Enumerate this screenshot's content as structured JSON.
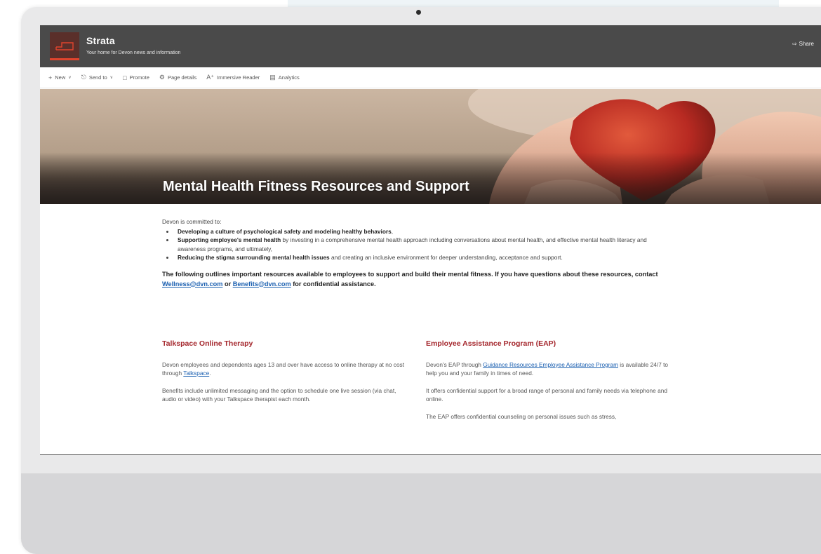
{
  "site": {
    "title": "Strata",
    "subtitle": "Your home for Devon news and information",
    "share_label": "Share"
  },
  "commands": [
    {
      "label": "New",
      "icon": "plus-icon",
      "has_dropdown": true
    },
    {
      "label": "Send to",
      "icon": "send-icon",
      "has_dropdown": true
    },
    {
      "label": "Promote",
      "icon": "promote-icon",
      "has_dropdown": false
    },
    {
      "label": "Page details",
      "icon": "gear-icon",
      "has_dropdown": false
    },
    {
      "label": "Immersive Reader",
      "icon": "immersive-reader-icon",
      "has_dropdown": false
    },
    {
      "label": "Analytics",
      "icon": "analytics-icon",
      "has_dropdown": false
    }
  ],
  "hero": {
    "title": "Mental Health Fitness Resources and Support"
  },
  "article": {
    "intro": "Devon is committed to:",
    "bullets": [
      {
        "bold": "Developing a culture of psychological safety and modeling healthy behaviors",
        "rest": ","
      },
      {
        "bold": "Supporting employee's mental health",
        "rest": " by investing in a comprehensive mental health approach including conversations about mental health, and effective mental health literacy and awareness programs, and ultimately,"
      },
      {
        "bold": "Reducing the stigma surrounding mental health issues",
        "rest": " and creating an inclusive environment for deeper understanding, acceptance and support."
      }
    ],
    "outline_text_1": "The following outlines important resources available to employees to support and build their mental fitness. If you have questions about these resources, contact ",
    "outline_link_1": "Wellness@dvn.com",
    "outline_text_2": " or ",
    "outline_link_2": "Benefits@dvn.com",
    "outline_text_3": " for confidential assistance."
  },
  "talkspace": {
    "heading": "Talkspace Online Therapy",
    "p1_text": "Devon employees and dependents ages 13 and over have access to online therapy at no cost through ",
    "p1_link": "Talkspace",
    "p1_end": ".",
    "p2": "Benefits include unlimited messaging and the option to schedule one live session (via chat, audio or video) with your Talkspace therapist each month."
  },
  "eap": {
    "heading": "Employee Assistance Program (EAP)",
    "p1_text": "Devon's EAP through ",
    "p1_link": "Guidance Resources Employee Assistance Program",
    "p1_end": " is available 24/7 to help you and your family in times of need.",
    "p2": "It offers confidential support for a broad range of personal and family needs via telephone and online.",
    "p3": "The EAP offers confidential counseling on personal issues such as stress,"
  },
  "colors": {
    "suitebar": "#4a4a4a",
    "accent": "#e0442d",
    "heading_red": "#a4262c",
    "link": "#1a5fb0"
  }
}
